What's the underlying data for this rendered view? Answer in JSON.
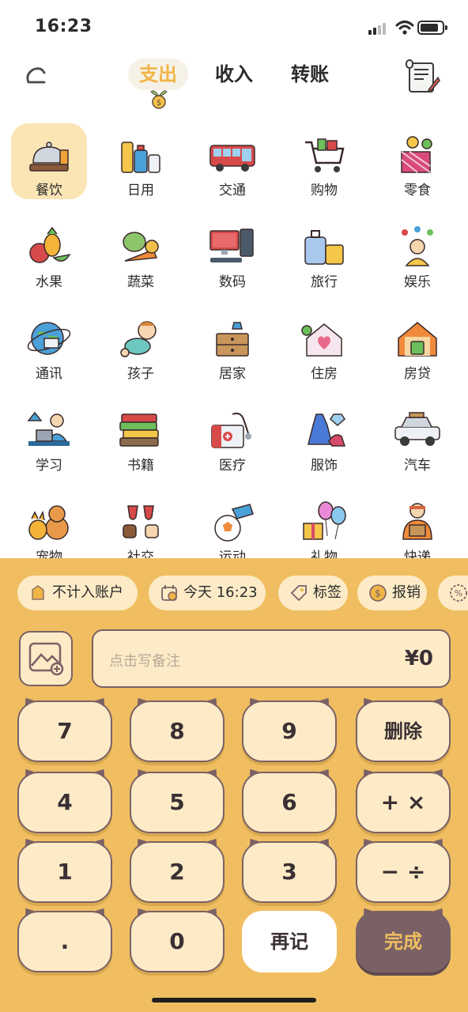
{
  "status_bar": {
    "time": "16:23"
  },
  "header": {
    "tabs": [
      "支出",
      "收入",
      "转账"
    ],
    "active_tab": "支出"
  },
  "categories": [
    {
      "label": "餐饮",
      "icon": "cloche-icon",
      "selected": true
    },
    {
      "label": "日用",
      "icon": "toiletries-icon"
    },
    {
      "label": "交通",
      "icon": "bus-icon"
    },
    {
      "label": "购物",
      "icon": "shopping-cart-icon"
    },
    {
      "label": "零食",
      "icon": "candy-icon"
    },
    {
      "label": "水果",
      "icon": "fruit-icon"
    },
    {
      "label": "蔬菜",
      "icon": "vegetable-icon"
    },
    {
      "label": "数码",
      "icon": "computer-icon"
    },
    {
      "label": "旅行",
      "icon": "luggage-icon"
    },
    {
      "label": "娱乐",
      "icon": "juggler-icon"
    },
    {
      "label": "通讯",
      "icon": "globe-mail-icon"
    },
    {
      "label": "孩子",
      "icon": "baby-icon"
    },
    {
      "label": "居家",
      "icon": "nightstand-icon"
    },
    {
      "label": "住房",
      "icon": "house-heart-icon"
    },
    {
      "label": "房贷",
      "icon": "house-money-icon"
    },
    {
      "label": "学习",
      "icon": "student-laptop-icon"
    },
    {
      "label": "书籍",
      "icon": "books-icon"
    },
    {
      "label": "医疗",
      "icon": "medical-kit-icon"
    },
    {
      "label": "服饰",
      "icon": "dress-icon"
    },
    {
      "label": "汽车",
      "icon": "car-icon"
    },
    {
      "label": "宠物",
      "icon": "pets-icon"
    },
    {
      "label": "社交",
      "icon": "cheers-icon"
    },
    {
      "label": "运动",
      "icon": "football-icon"
    },
    {
      "label": "礼物",
      "icon": "gift-balloon-icon"
    },
    {
      "label": "快递",
      "icon": "courier-icon"
    }
  ],
  "chips": [
    {
      "label": "不计入账户",
      "icon": "wallet-icon"
    },
    {
      "label": "今天 16:23",
      "icon": "calendar-icon"
    },
    {
      "label": "标签",
      "icon": "tag-icon"
    },
    {
      "label": "报销",
      "icon": "coin-icon"
    },
    {
      "label": "",
      "icon": "discount-icon"
    }
  ],
  "note": {
    "placeholder": "点击写备注",
    "amount": "¥0"
  },
  "keypad": {
    "rows": [
      [
        "7",
        "8",
        "9",
        "删除"
      ],
      [
        "4",
        "5",
        "6",
        "+ ×"
      ],
      [
        "1",
        "2",
        "3",
        "− ÷"
      ],
      [
        ".",
        "0",
        "再记",
        "完成"
      ]
    ]
  },
  "colors": {
    "accent": "#f0b447",
    "panel": "#f0be60",
    "key_bg": "#fcebc6",
    "key_border": "#7a6166",
    "selected_bg": "#fbe5b5"
  }
}
